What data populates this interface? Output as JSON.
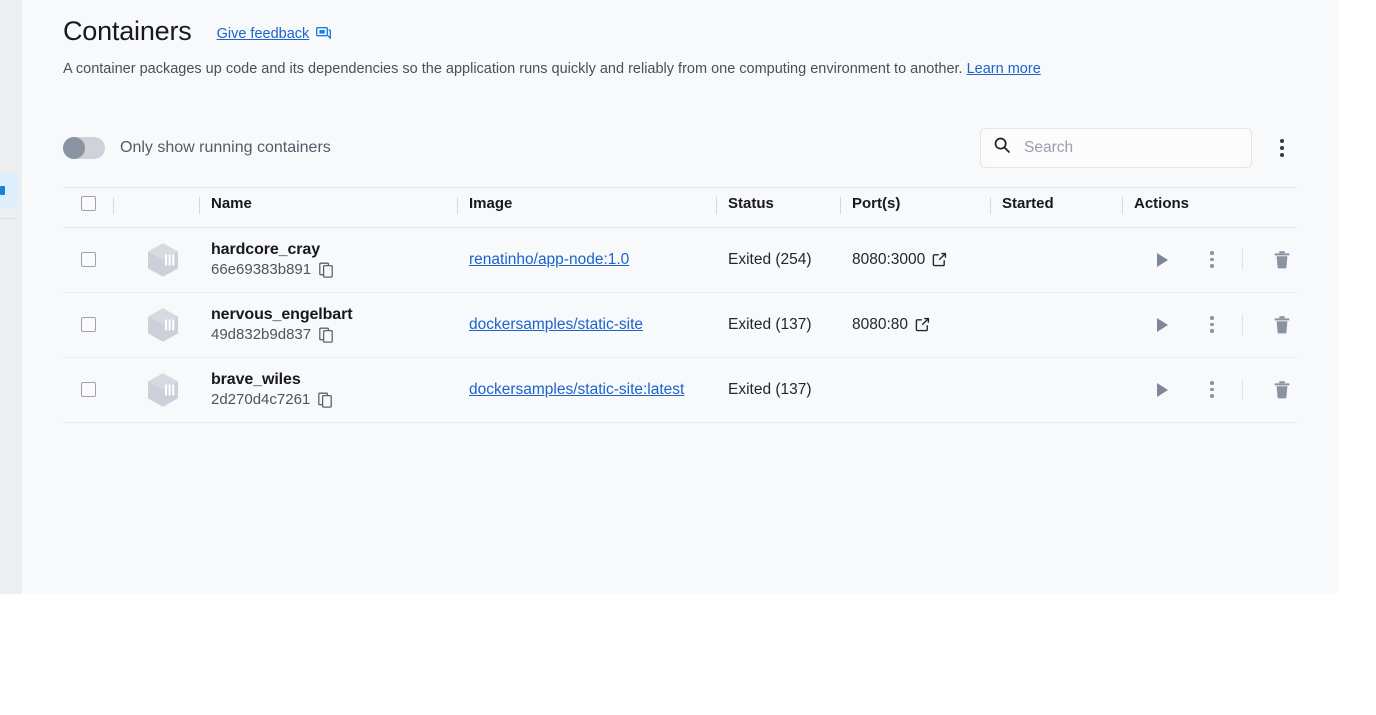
{
  "sidebar": {
    "selected_item": "containers"
  },
  "header": {
    "title": "Containers",
    "feedback_label": "Give feedback",
    "feedback_icon": "feedback-icon",
    "description": "A container packages up code and its dependencies so the application runs quickly and reliably from one computing environment to another.",
    "learn_more_label": "Learn more"
  },
  "toolbar": {
    "toggle_label": "Only show running containers",
    "toggle_state": "off",
    "search": {
      "value": "",
      "placeholder": "Search",
      "icon": "search-icon"
    },
    "overflow_icon": "kebab-menu-icon"
  },
  "table": {
    "columns": [
      "Name",
      "Image",
      "Status",
      "Port(s)",
      "Started",
      "Actions"
    ],
    "rows": [
      {
        "name": "hardcore_cray",
        "container_id": "66e69383b891",
        "image": "renatinho/app-node:1.0",
        "status": "Exited (254)",
        "ports": "8080:3000",
        "started": "",
        "icon": "container-cube-icon"
      },
      {
        "name": "nervous_engelbart",
        "container_id": "49d832b9d837",
        "image": "dockersamples/static-site",
        "status": "Exited (137)",
        "ports": "8080:80",
        "started": "",
        "icon": "container-cube-icon"
      },
      {
        "name": "brave_wiles",
        "container_id": "2d270d4c7261",
        "image": "dockersamples/static-site:latest",
        "status": "Exited (137)",
        "ports": "",
        "started": "",
        "icon": "container-cube-icon"
      }
    ]
  },
  "colors": {
    "link": "#1c63cc",
    "panel_bg": "#f8f9fa",
    "sidebar_bg": "#eceef0",
    "selection_bg": "#ddeffc",
    "icon_grey": "#8b93a3",
    "text": "#17191c"
  }
}
